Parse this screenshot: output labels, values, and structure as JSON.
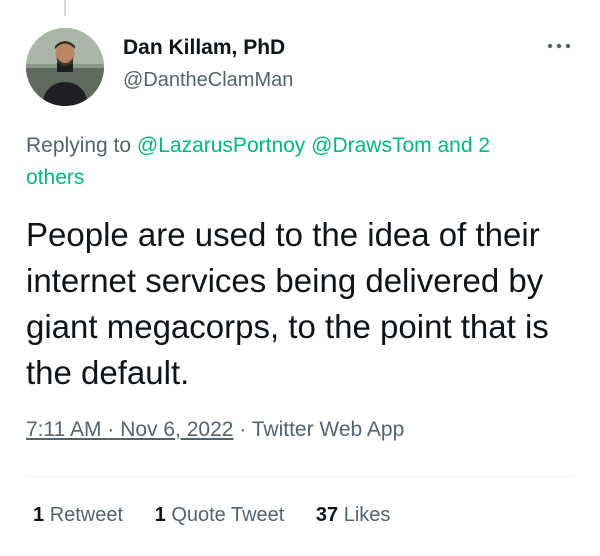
{
  "author": {
    "display_name": "Dan Killam, PhD",
    "handle": "@DantheClamMan"
  },
  "reply_context": {
    "prefix": "Replying to",
    "mentions": [
      "@LazarusPortnoy",
      "@DrawsTom"
    ],
    "others": "and 2 others"
  },
  "tweet": {
    "text": "People are used to the idea of their internet services being delivered by giant megacorps, to the point that is the default.",
    "time": "7:11 AM",
    "separator": "·",
    "date": "Nov 6, 2022",
    "source": "Twitter Web App"
  },
  "stats": {
    "retweets_count": "1",
    "retweets_label": "Retweet",
    "quotes_count": "1",
    "quotes_label": "Quote Tweet",
    "likes_count": "37",
    "likes_label": "Likes"
  },
  "icons": {
    "more": "more-horizontal-icon",
    "avatar": "profile-photo"
  },
  "colors": {
    "mention": "#00ba7c",
    "secondary_text": "#536471",
    "primary_text": "#0f1419"
  }
}
